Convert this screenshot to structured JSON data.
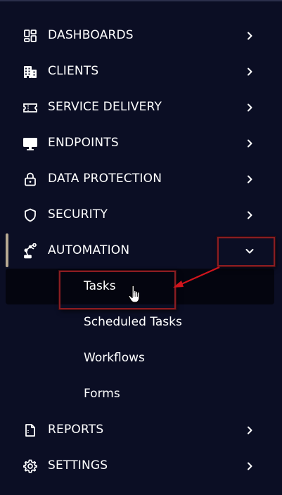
{
  "menu": {
    "items": [
      {
        "label": "DASHBOARDS",
        "icon": "dashboard-icon"
      },
      {
        "label": "CLIENTS",
        "icon": "building-icon"
      },
      {
        "label": "SERVICE DELIVERY",
        "icon": "ticket-icon"
      },
      {
        "label": "ENDPOINTS",
        "icon": "monitor-icon"
      },
      {
        "label": "DATA PROTECTION",
        "icon": "lock-icon"
      },
      {
        "label": "SECURITY",
        "icon": "shield-icon"
      },
      {
        "label": "AUTOMATION",
        "icon": "robot-arm-icon",
        "expanded": true
      },
      {
        "label": "REPORTS",
        "icon": "report-icon"
      },
      {
        "label": "SETTINGS",
        "icon": "gear-icon"
      }
    ],
    "automation_subitems": [
      {
        "label": "Tasks",
        "active": true
      },
      {
        "label": "Scheduled Tasks"
      },
      {
        "label": "Workflows"
      },
      {
        "label": "Forms"
      }
    ]
  },
  "colors": {
    "background": "#0b0e24",
    "active_row": "#04050f",
    "active_indicator": "#b7a992",
    "annotation": "#8a1d22",
    "arrow": "#d1141c",
    "text": "#ffffff"
  }
}
